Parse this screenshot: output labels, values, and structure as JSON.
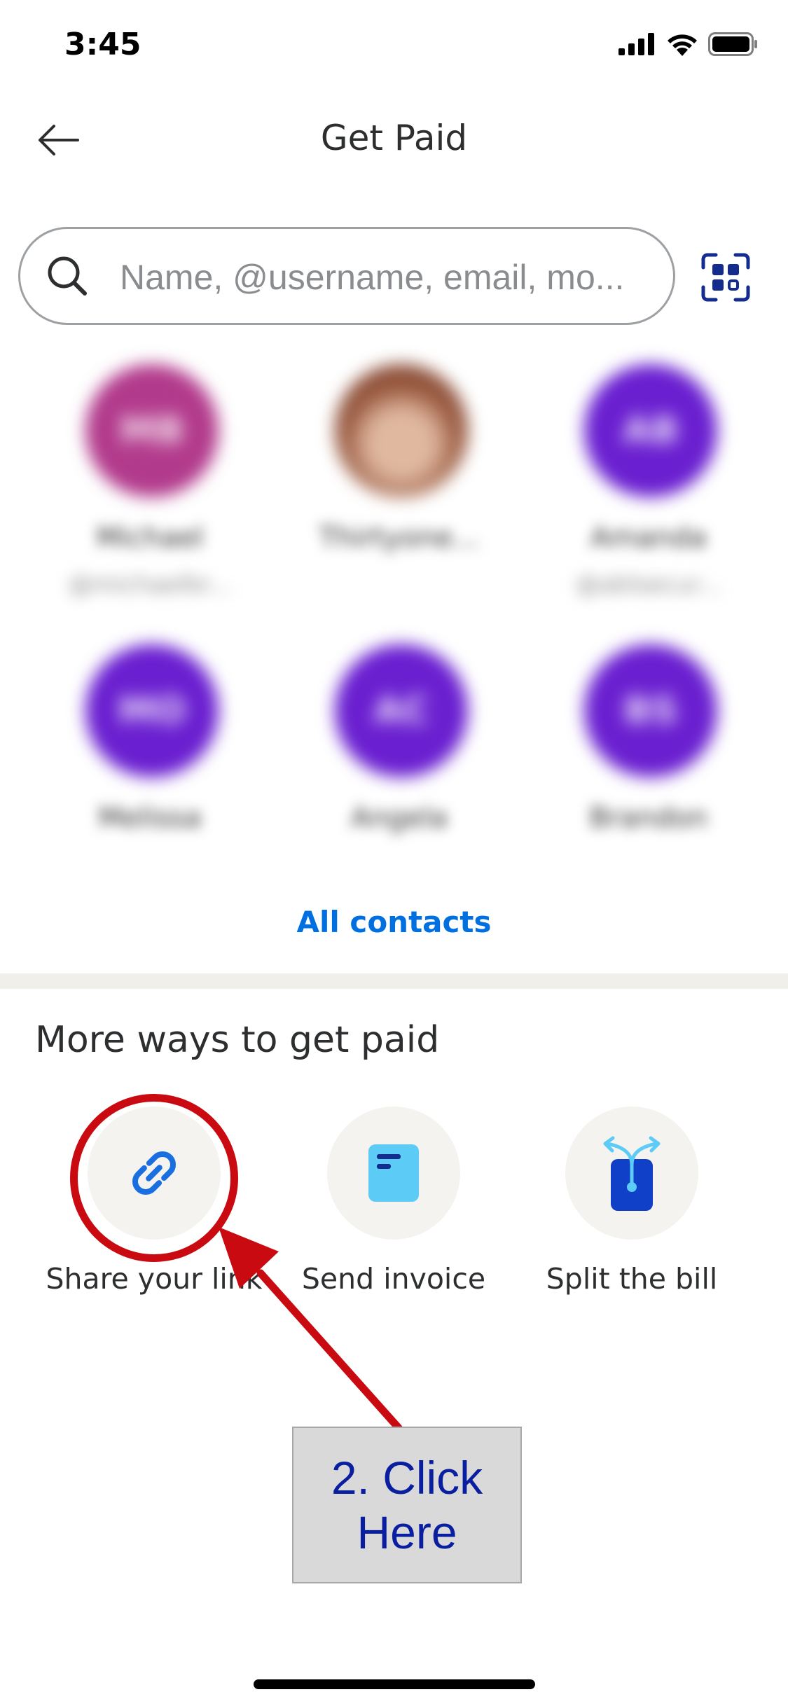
{
  "status_bar": {
    "time": "3:45"
  },
  "header": {
    "title": "Get Paid"
  },
  "search": {
    "placeholder": "Name, @username, email, mo..."
  },
  "contacts": [
    {
      "initials": "MB",
      "name": "Michael",
      "handle": "@michaelbr...",
      "color": "#b23a8c"
    },
    {
      "initials": "",
      "name": "Thirtyone...",
      "handle": "",
      "color": "#9a5a40"
    },
    {
      "initials": "AB",
      "name": "Amanda",
      "handle": "@ablsecur...",
      "color": "#6a1fd0"
    },
    {
      "initials": "MO",
      "name": "Melissa",
      "handle": "",
      "color": "#6a1fd0"
    },
    {
      "initials": "AC",
      "name": "Angela",
      "handle": "",
      "color": "#6a1fd0"
    },
    {
      "initials": "BS",
      "name": "Brandon",
      "handle": "",
      "color": "#6a1fd0"
    }
  ],
  "all_contacts_label": "All contacts",
  "more_ways": {
    "title": "More ways to get paid",
    "items": [
      {
        "label": "Share your link",
        "icon": "link-icon"
      },
      {
        "label": "Send invoice",
        "icon": "invoice-icon"
      },
      {
        "label": "Split the bill",
        "icon": "split-bill-icon"
      }
    ]
  },
  "annotation": {
    "line1": "2. Click",
    "line2": "Here"
  },
  "colors": {
    "accent": "#0070e0",
    "annotation_red": "#c90a10",
    "annotation_text": "#0a1ea0"
  }
}
